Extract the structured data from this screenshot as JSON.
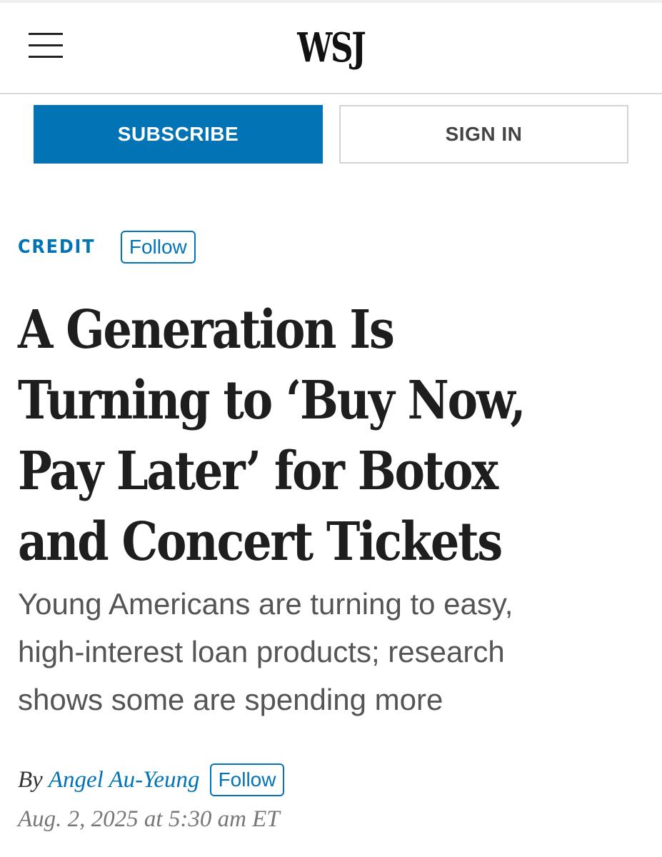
{
  "header": {
    "logo": "WSJ",
    "menu_icon": "hamburger-menu-icon"
  },
  "auth": {
    "subscribe_label": "SUBSCRIBE",
    "signin_label": "SIGN IN"
  },
  "section": {
    "label": "CREDIT",
    "follow_label": "Follow"
  },
  "article": {
    "headline_lines": [
      "A Generation Is",
      "Turning to ‘Buy Now,",
      "Pay Later’ for Botox",
      "and Concert Tickets"
    ],
    "dek_lines": [
      "Young Americans are turning to easy,",
      "high-interest loan products; research",
      "shows some are spending more"
    ],
    "byline_prefix": "By",
    "author": "Angel Au-Yeung",
    "author_follow_label": "Follow",
    "timestamp": "Aug. 2, 2025 at 5:30 am ET"
  },
  "colors": {
    "accent": "#0274b6",
    "headline": "#1e1e1e",
    "dek": "#555555",
    "timestamp": "#777777"
  }
}
